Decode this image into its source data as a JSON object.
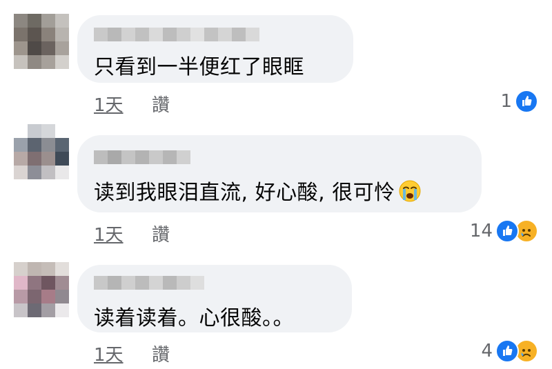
{
  "comments": [
    {
      "text": "只看到一半便红了眼眶",
      "time": "1天",
      "like_label": "讚",
      "reaction_count": "1",
      "reactions": [
        "like-icon"
      ],
      "has_emoji": false
    },
    {
      "text": "读到我眼泪直流, 好心酸, 很可怜",
      "time": "1天",
      "like_label": "讚",
      "reaction_count": "14",
      "reactions": [
        "like-icon",
        "sad-icon"
      ],
      "has_emoji": true,
      "emoji": "loudly-crying-face-icon"
    },
    {
      "text": "读着读着。心很酸。。",
      "time": "1天",
      "like_label": "讚",
      "reaction_count": "4",
      "reactions": [
        "like-icon",
        "sad-icon"
      ],
      "has_emoji": false
    }
  ],
  "colors": {
    "bubble": "#f0f2f5",
    "meta_text": "#65676b",
    "like_blue": "#1877f2",
    "sad_yellow": "#f7b125"
  }
}
